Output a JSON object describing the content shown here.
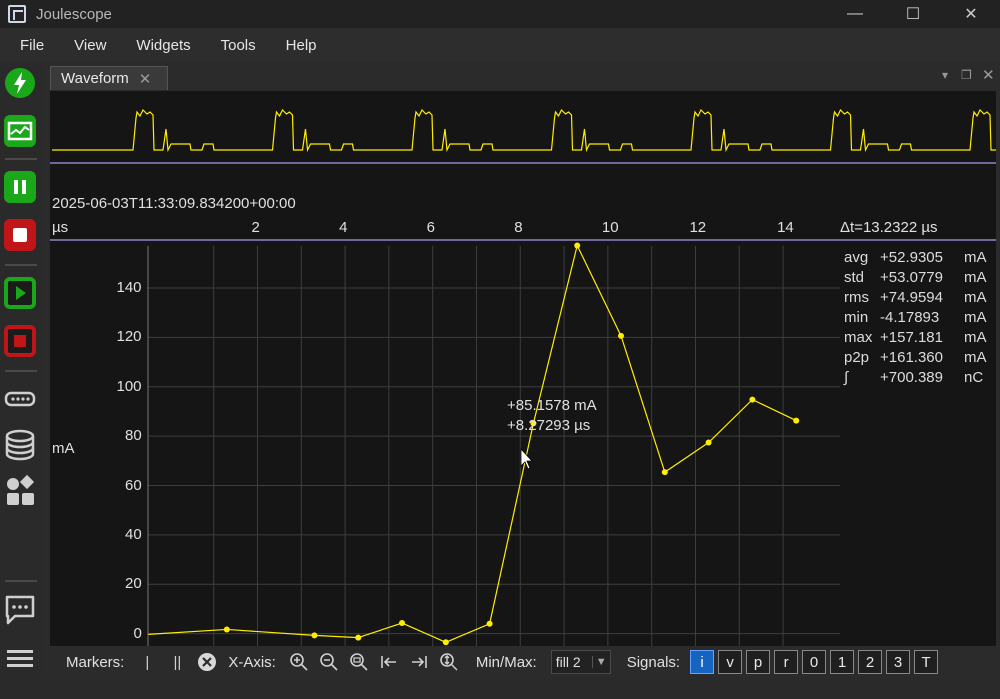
{
  "app": {
    "title": "Joulescope",
    "icon": "joulescope-logo-icon"
  },
  "window_controls": {
    "minimize": "—",
    "maximize": "☐",
    "close": "✕"
  },
  "menu": [
    "File",
    "View",
    "Widgets",
    "Tools",
    "Help"
  ],
  "sidebar": [
    {
      "name": "device-power-icon",
      "color": "#1aa81a"
    },
    {
      "name": "waveform-view-icon",
      "color": "#1aa81a"
    },
    {
      "name": "pause-icon",
      "color": "#1aa81a"
    },
    {
      "name": "stop-icon",
      "color": "#c0161a"
    },
    {
      "name": "play-record-icon",
      "color": "#1aa81a"
    },
    {
      "name": "stop-record-icon",
      "color": "#c0161a"
    },
    {
      "name": "memory-icon",
      "color": "#cfcfcf"
    },
    {
      "name": "database-icon",
      "color": "#cfcfcf"
    },
    {
      "name": "widgets-icon",
      "color": "#cfcfcf"
    },
    {
      "name": "chat-icon",
      "color": "#cfcfcf"
    },
    {
      "name": "hamburger-menu-icon",
      "color": "#cfcfcf"
    }
  ],
  "tab": {
    "label": "Waveform",
    "close": "✕"
  },
  "dock_controls": {
    "float": "▾",
    "restore": "❐",
    "close": "✕"
  },
  "waveform": {
    "timestamp": "2025-06-03T11:33:09.834200+00:00",
    "x_unit": "µs",
    "x_ticks": [
      "2",
      "4",
      "6",
      "8",
      "10",
      "12",
      "14"
    ],
    "delta_t": "Δt=13.2322 µs",
    "y_unit": "mA",
    "y_ticks": [
      "140",
      "120",
      "100",
      "80",
      "60",
      "40",
      "20",
      "0"
    ],
    "cursor_readout": {
      "value": "+85.1578 mA",
      "time": "+8.27293 µs"
    },
    "trace_color": "#ffee00",
    "stats": [
      {
        "name": "avg",
        "value": "+52.9305",
        "unit": "mA"
      },
      {
        "name": "std",
        "value": "+53.0779",
        "unit": "mA"
      },
      {
        "name": "rms",
        "value": "+74.9594",
        "unit": "mA"
      },
      {
        "name": "min",
        "value": "-4.17893",
        "unit": "mA"
      },
      {
        "name": "max",
        "value": "+157.181",
        "unit": "mA"
      },
      {
        "name": "p2p",
        "value": "+161.360",
        "unit": "mA"
      },
      {
        "name": "∫",
        "value": "+700.389",
        "unit": "nC"
      }
    ]
  },
  "chart_data": {
    "type": "line",
    "title": "",
    "xlabel": "µs",
    "ylabel": "mA",
    "xlim": [
      -0.5,
      15.3
    ],
    "ylim": [
      -5,
      157
    ],
    "series": [
      {
        "x": [
          -0.5,
          1.3,
          3.3,
          4.3,
          5.3,
          6.3,
          7.3,
          8.3,
          9.3,
          10.3,
          11.3,
          12.3,
          13.3,
          14.3
        ],
        "y": [
          -0.3,
          1.7,
          -0.7,
          -1.6,
          4.3,
          -3.5,
          4.0,
          85.2,
          157.2,
          120.6,
          65.4,
          77.4,
          94.8,
          86.3
        ]
      }
    ],
    "grid": true
  },
  "overview": {
    "type": "line",
    "period_count": 7
  },
  "bottom": {
    "markers_label": "Markers:",
    "marker_single": "|",
    "marker_dual": "||",
    "xaxis_label": "X-Axis:",
    "minmax_label": "Min/Max:",
    "fill_value": "fill 2",
    "signals_label": "Signals:",
    "signals": [
      "i",
      "v",
      "p",
      "r",
      "0",
      "1",
      "2",
      "3",
      "T"
    ]
  }
}
